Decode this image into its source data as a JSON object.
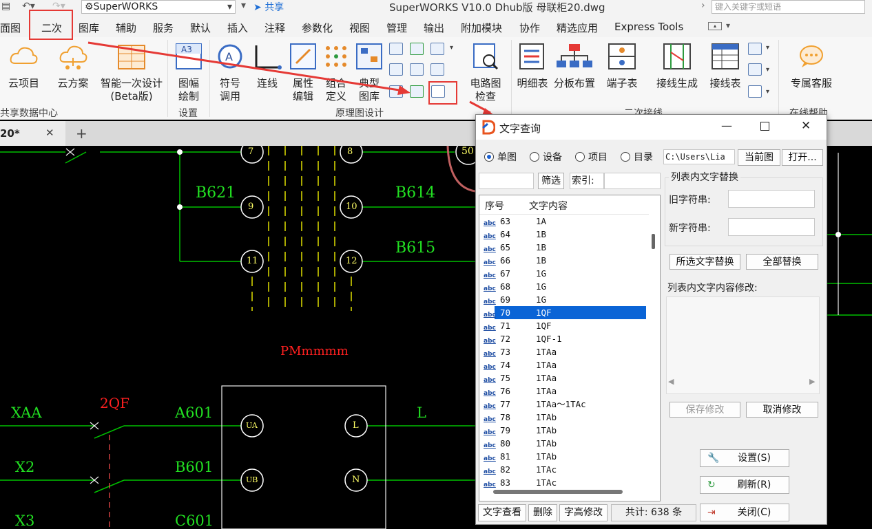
{
  "titlebar": {
    "profile": "SuperWORKS",
    "share": "共享",
    "app_title": "SuperWORKS V10.0 Dhub版    母联柜20.dwg",
    "search_placeholder": "键入关键字或短语"
  },
  "menu": [
    "面图",
    "二次",
    "图库",
    "辅助",
    "服务",
    "默认",
    "插入",
    "注释",
    "参数化",
    "视图",
    "管理",
    "输出",
    "附加模块",
    "协作",
    "精选应用",
    "Express Tools"
  ],
  "ribbon": {
    "buttons": {
      "cloud_project": "云项目",
      "cloud_scheme": "云方案",
      "smart_design_1": "智能一次设计",
      "smart_design_2": "(Beta版)",
      "frame_1": "图幅",
      "frame_2": "绘制",
      "symbol_1": "符号",
      "symbol_2": "调用",
      "wire": "连线",
      "attr_1": "属性",
      "attr_2": "编辑",
      "combo_1": "组合",
      "combo_2": "定义",
      "typical_1": "典型",
      "typical_2": "图库",
      "circuit_1": "电路图",
      "circuit_2": "检查",
      "detail_table": "明细表",
      "board_layout": "分板布置",
      "terminal_table": "端子表",
      "wiring_gen": "接线生成",
      "wiring_table": "接线表",
      "support": "专属客服"
    },
    "groups": {
      "shared": "共享数据中心",
      "settings": "设置",
      "schematic": "原理图设计",
      "secondary_wiring": "二次接线",
      "online_help": "在线帮助"
    }
  },
  "doc_tab": {
    "label": "20*",
    "close": "✕",
    "add": "+"
  },
  "canvas": {
    "labels": {
      "b621": "B621",
      "b614": "B614",
      "b615": "B615",
      "pm": "PMmmmm",
      "qf": "2QF",
      "xaa": "XAA",
      "x2": "X2",
      "x3": "X3",
      "a601": "A601",
      "b601": "B601",
      "c601": "C601",
      "l": "L"
    },
    "circles": {
      "c7": "7",
      "c8": "8",
      "c9": "9",
      "c10": "10",
      "c11": "11",
      "c12": "12",
      "c50": "50",
      "ua": "UA",
      "ub": "UB",
      "cl": "L",
      "cn": "N"
    }
  },
  "dialog": {
    "title": "文字查询",
    "scope_options": [
      "单图",
      "设备",
      "项目",
      "目录"
    ],
    "path": "C:\\Users\\Lia",
    "btn_current": "当前图",
    "btn_open": "打开...",
    "btn_filter": "筛选",
    "index_label": "索引:",
    "col_no": "序号",
    "col_text": "文字内容",
    "rows": [
      {
        "no": "63",
        "text": "1A"
      },
      {
        "no": "64",
        "text": "1B"
      },
      {
        "no": "65",
        "text": "1B"
      },
      {
        "no": "66",
        "text": "1B"
      },
      {
        "no": "67",
        "text": "1G"
      },
      {
        "no": "68",
        "text": "1G"
      },
      {
        "no": "69",
        "text": "1G"
      },
      {
        "no": "70",
        "text": "1QF"
      },
      {
        "no": "71",
        "text": "1QF"
      },
      {
        "no": "72",
        "text": "1QF-1"
      },
      {
        "no": "73",
        "text": "1TAa"
      },
      {
        "no": "74",
        "text": "1TAa"
      },
      {
        "no": "75",
        "text": "1TAa"
      },
      {
        "no": "76",
        "text": "1TAa"
      },
      {
        "no": "77",
        "text": "1TAa～1TAc"
      },
      {
        "no": "78",
        "text": "1TAb"
      },
      {
        "no": "79",
        "text": "1TAb"
      },
      {
        "no": "80",
        "text": "1TAb"
      },
      {
        "no": "81",
        "text": "1TAb"
      },
      {
        "no": "82",
        "text": "1TAc"
      },
      {
        "no": "83",
        "text": "1TAc"
      }
    ],
    "selected_no": "70",
    "row_icon": "abc",
    "replace_group": "列表内文字替换",
    "old_label": "旧字符串:",
    "new_label": "新字符串:",
    "btn_replace_sel": "所选文字替换",
    "btn_replace_all": "全部替换",
    "modify_label": "列表内文字内容修改:",
    "btn_save": "保存修改",
    "btn_cancel": "取消修改",
    "btn_settings": "设置(S)",
    "btn_refresh": "刷新(R)",
    "btn_close": "关闭(C)",
    "btn_view": "文字查看",
    "btn_delete": "删除",
    "btn_height": "字高修改",
    "total": "共计: 638 条"
  },
  "colors": {
    "highlight": "#e53935",
    "selection": "#0a64d6",
    "wire": "#00c000",
    "label_green": "#22e022",
    "label_red": "#ff2020",
    "circle_text": "#ffff66"
  }
}
